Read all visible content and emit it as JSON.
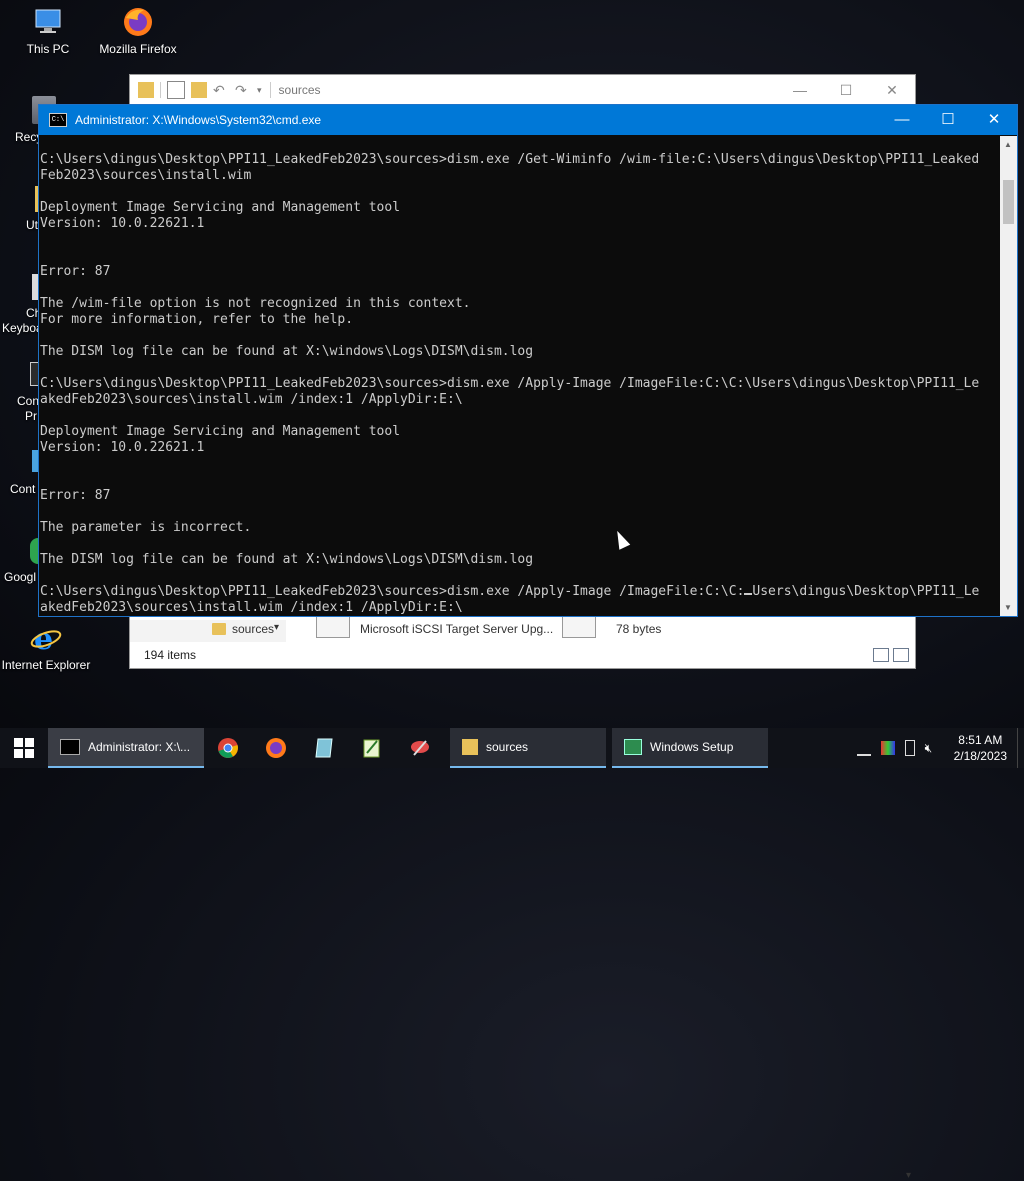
{
  "desktop": {
    "icons": [
      {
        "label": "This PC",
        "icon": "this-pc-icon"
      },
      {
        "label": "Mozilla Firefox",
        "icon": "firefox-icon"
      },
      {
        "label": "Internet Explorer",
        "icon": "internet-explorer-icon"
      }
    ],
    "partial_labels": [
      "Recy",
      "Ut",
      "Ch",
      "Keyboa",
      "Conf",
      "Pr",
      "Cont",
      "Googl"
    ]
  },
  "explorer": {
    "address": "sources",
    "nav_folder": "sources",
    "file1_name": "Microsoft iSCSI Target Server Upg...",
    "file2_size": "78 bytes",
    "status": "194 items"
  },
  "cmd": {
    "title": "Administrator: X:\\Windows\\System32\\cmd.exe",
    "icon_text": "C:\\",
    "console_lines": [
      "C:\\Users\\dingus\\Desktop\\PPI11_LeakedFeb2023\\sources>dism.exe /Get-Wiminfo /wim-file:C:\\Users\\dingus\\Desktop\\PPI11_Leaked",
      "Feb2023\\sources\\install.wim",
      "",
      "Deployment Image Servicing and Management tool",
      "Version: 10.0.22621.1",
      "",
      "",
      "Error: 87",
      "",
      "The /wim-file option is not recognized in this context.",
      "For more information, refer to the help.",
      "",
      "The DISM log file can be found at X:\\windows\\Logs\\DISM\\dism.log",
      "",
      "C:\\Users\\dingus\\Desktop\\PPI11_LeakedFeb2023\\sources>dism.exe /Apply-Image /ImageFile:C:\\C:\\Users\\dingus\\Desktop\\PPI11_Le",
      "akedFeb2023\\sources\\install.wim /index:1 /ApplyDir:E:\\",
      "",
      "Deployment Image Servicing and Management tool",
      "Version: 10.0.22621.1",
      "",
      "",
      "Error: 87",
      "",
      "The parameter is incorrect.",
      "",
      "The DISM log file can be found at X:\\windows\\Logs\\DISM\\dism.log",
      ""
    ],
    "last_line_a": "C:\\Users\\dingus\\Desktop\\PPI11_LeakedFeb2023\\sources>dism.exe /Apply-Image /ImageFile:C:\\C:",
    "last_line_b": "Users\\dingus\\Desktop\\PPI11_Le",
    "final_line": "akedFeb2023\\sources\\install.wim /index:1 /ApplyDir:E:\\"
  },
  "taskbar": {
    "tasks": [
      {
        "label": "Administrator: X:\\...",
        "icon": "cmd-icon"
      },
      {
        "label": "sources",
        "icon": "folder-icon"
      },
      {
        "label": "Windows Setup",
        "icon": "windows-setup-icon"
      }
    ],
    "pinned": [
      "chrome-icon",
      "firefox-icon",
      "notepad-icon",
      "notepadpp-icon",
      "snipping-tool-icon"
    ],
    "time": "8:51 AM",
    "date": "2/18/2023"
  },
  "colors": {
    "cmd_titlebar": "#0078d7",
    "console_bg": "#0c0c0c",
    "console_fg": "#cccccc",
    "taskbar_bg": "#101218"
  }
}
